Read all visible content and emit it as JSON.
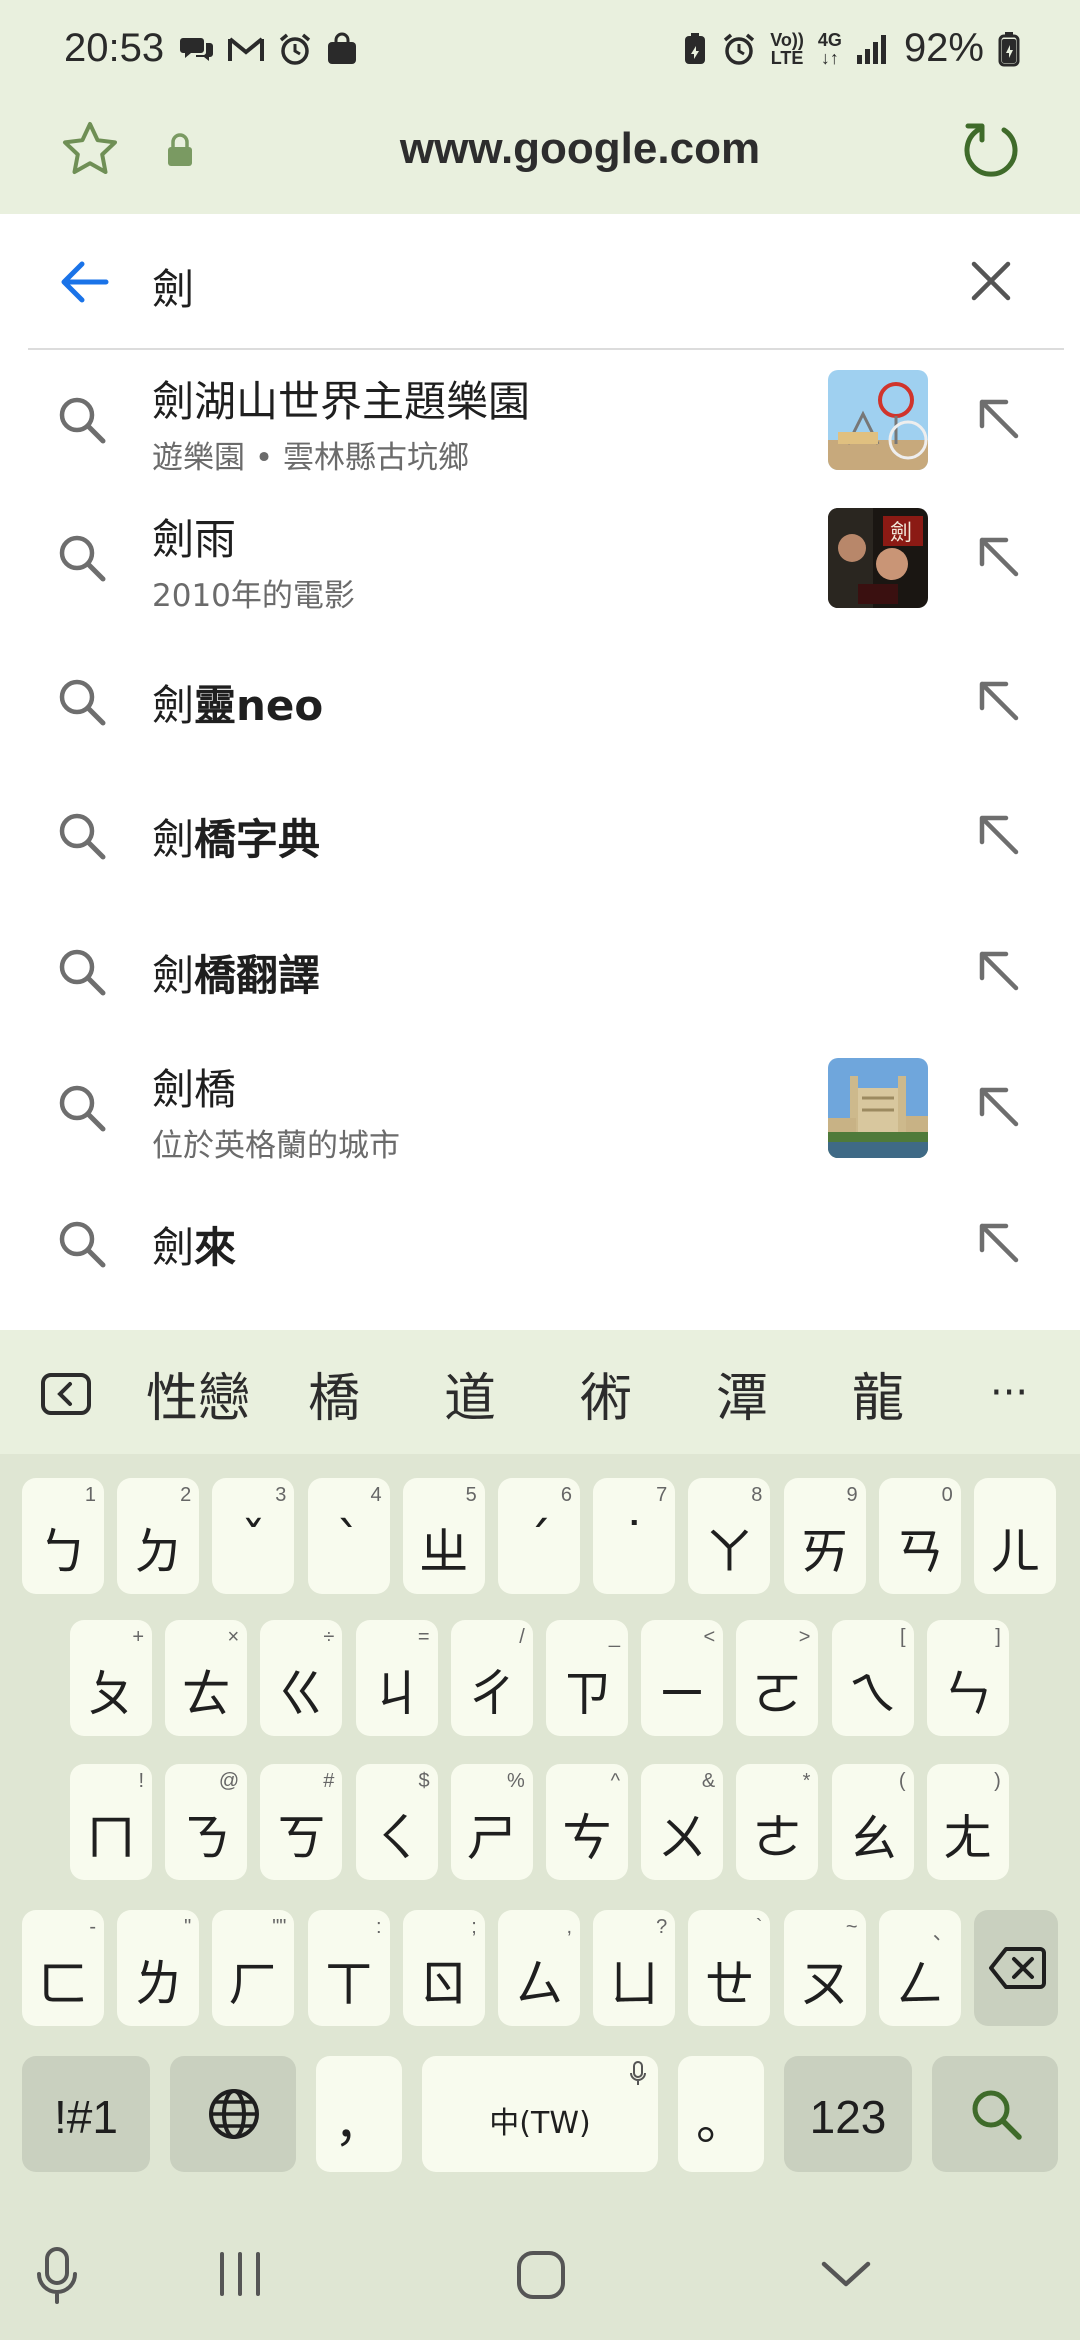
{
  "status_bar": {
    "time": "20:53",
    "battery": "92%",
    "network_lines": [
      "Vo))",
      "LTE"
    ],
    "net_type": "4G"
  },
  "address_bar": {
    "url": "www.google.com"
  },
  "search": {
    "query": "劍"
  },
  "suggestions": [
    {
      "prefix": "劍",
      "rest": "湖山世界主題樂園",
      "bold_rest": false,
      "subtitle": "遊樂園 • 雲林縣古坑鄉",
      "thumbnail": "theme-park-photo"
    },
    {
      "prefix": "劍",
      "rest": "雨",
      "bold_rest": false,
      "subtitle": "2010年的電影",
      "thumbnail": "movie-poster"
    },
    {
      "prefix": "劍",
      "rest": "靈neo",
      "bold_rest": true,
      "subtitle": "",
      "thumbnail": ""
    },
    {
      "prefix": "劍",
      "rest": "橋字典",
      "bold_rest": true,
      "subtitle": "",
      "thumbnail": ""
    },
    {
      "prefix": "劍",
      "rest": "橋翻譯",
      "bold_rest": true,
      "subtitle": "",
      "thumbnail": ""
    },
    {
      "prefix": "劍",
      "rest": "橋",
      "bold_rest": false,
      "subtitle": "位於英格蘭的城市",
      "thumbnail": "cambridge-photo"
    },
    {
      "prefix": "劍",
      "rest": "來",
      "bold_rest": true,
      "subtitle": "",
      "thumbnail": ""
    }
  ],
  "keyboard": {
    "candidates": [
      "性戀",
      "橋",
      "道",
      "術",
      "潭",
      "龍"
    ],
    "more": "···",
    "row1": [
      {
        "key": "ㄅ",
        "hint": "1"
      },
      {
        "key": "ㄉ",
        "hint": "2"
      },
      {
        "key": "ˇ",
        "hint": "3"
      },
      {
        "key": "ˋ",
        "hint": "4"
      },
      {
        "key": "ㄓ",
        "hint": "5"
      },
      {
        "key": "ˊ",
        "hint": "6"
      },
      {
        "key": "˙",
        "hint": "7"
      },
      {
        "key": "ㄚ",
        "hint": "8"
      },
      {
        "key": "ㄞ",
        "hint": "9"
      },
      {
        "key": "ㄢ",
        "hint": "0"
      },
      {
        "key": "ㄦ",
        "hint": ""
      }
    ],
    "row2": [
      {
        "key": "ㄆ",
        "hint": "+"
      },
      {
        "key": "ㄊ",
        "hint": "×"
      },
      {
        "key": "ㄍ",
        "hint": "÷"
      },
      {
        "key": "ㄐ",
        "hint": "="
      },
      {
        "key": "ㄔ",
        "hint": "/"
      },
      {
        "key": "ㄗ",
        "hint": "_"
      },
      {
        "key": "ㄧ",
        "hint": "<"
      },
      {
        "key": "ㄛ",
        "hint": ">"
      },
      {
        "key": "ㄟ",
        "hint": "["
      },
      {
        "key": "ㄣ",
        "hint": "]"
      }
    ],
    "row3": [
      {
        "key": "ㄇ",
        "hint": "!"
      },
      {
        "key": "ㄋ",
        "hint": "@"
      },
      {
        "key": "ㄎ",
        "hint": "#"
      },
      {
        "key": "ㄑ",
        "hint": "$"
      },
      {
        "key": "ㄕ",
        "hint": "%"
      },
      {
        "key": "ㄘ",
        "hint": "^"
      },
      {
        "key": "ㄨ",
        "hint": "&"
      },
      {
        "key": "ㄜ",
        "hint": "*"
      },
      {
        "key": "ㄠ",
        "hint": "("
      },
      {
        "key": "ㄤ",
        "hint": ")"
      }
    ],
    "row4": [
      {
        "key": "ㄈ",
        "hint": "-"
      },
      {
        "key": "ㄌ",
        "hint": "\""
      },
      {
        "key": "ㄏ",
        "hint": "\"\""
      },
      {
        "key": "ㄒ",
        "hint": ":"
      },
      {
        "key": "ㄖ",
        "hint": ";"
      },
      {
        "key": "ㄙ",
        "hint": ","
      },
      {
        "key": "ㄩ",
        "hint": "?"
      },
      {
        "key": "ㄝ",
        "hint": "`"
      },
      {
        "key": "ㄡ",
        "hint": "~"
      },
      {
        "key": "ㄥ",
        "hint": "、"
      }
    ],
    "sym_key": "!#1",
    "comma_key": "，",
    "space_label": "中(TW)",
    "period_key": "。",
    "num_key": "123"
  },
  "colors": {
    "accent_blue": "#1a73e8",
    "topbar_bg": "#e9f0de",
    "keyboard_bg": "#dfe6d3",
    "key_bg": "#f8fbee",
    "func_key_bg": "#c9d0bf",
    "reload_green": "#3f6b2a"
  },
  "icons": {
    "star": "star-icon",
    "lock": "lock-icon",
    "reload": "reload-icon",
    "back": "back-arrow-icon",
    "clear": "close-icon",
    "search": "search-icon",
    "fill": "arrow-up-left-icon",
    "globe": "globe-icon",
    "backspace": "backspace-icon",
    "enter": "search-icon",
    "mic": "microphone-icon"
  }
}
